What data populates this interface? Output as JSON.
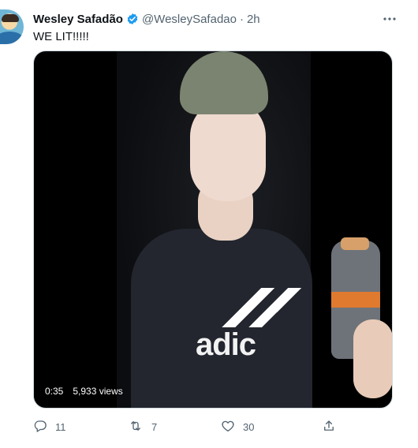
{
  "tweet": {
    "author_name": "Wesley Safadão",
    "handle": "@WesleySafadao",
    "separator": "·",
    "time": "2h",
    "text": "WE LIT!!!!!"
  },
  "video": {
    "duration": "0:35",
    "views": "5,933 views"
  },
  "actions": {
    "reply_count": "11",
    "retweet_count": "7",
    "like_count": "30"
  },
  "icons": {
    "verified": "verified-badge-icon",
    "more": "more-icon",
    "reply": "reply-icon",
    "retweet": "retweet-icon",
    "like": "heart-icon",
    "share": "share-icon"
  },
  "colors": {
    "verified": "#1d9bf0",
    "muted": "#536471",
    "text": "#0f1419"
  }
}
